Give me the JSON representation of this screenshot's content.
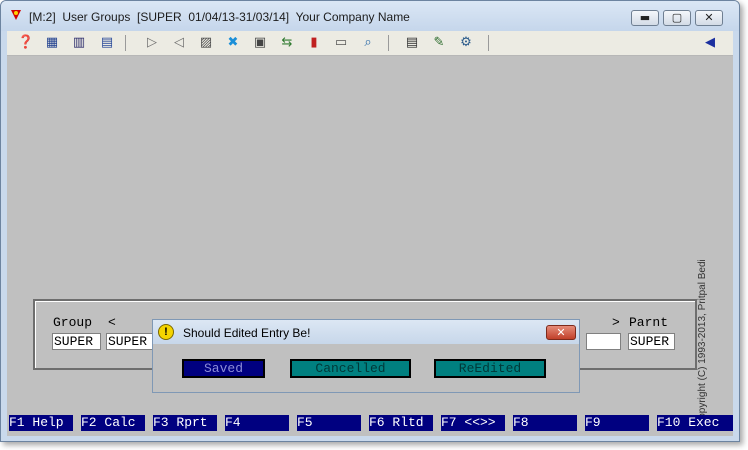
{
  "window": {
    "title": "[M:2]  User Groups  [SUPER  01/04/13-31/03/14]  Your Company Name",
    "controls": {
      "minimize": "▬",
      "maximize": "▢",
      "close": "✕"
    }
  },
  "toolbar": {
    "icons": [
      "help-icon",
      "grid-icon",
      "calculator-icon",
      "report-icon",
      "next-icon",
      "previous-icon",
      "document-icon",
      "tools-icon",
      "notes-icon",
      "transfer-icon",
      "chart-icon",
      "print-icon",
      "find-icon",
      "clipboard-icon",
      "edit-icon",
      "settings-icon",
      "exit-icon"
    ]
  },
  "copyright": "Copyright (C) 1993-2013, Pritpal Bedi",
  "form": {
    "group_label": "Group",
    "lt_marker": "<",
    "gt_marker": ">",
    "parent_label": "Parnt",
    "group_value": "SUPER",
    "name_value": "SUPER",
    "parent_value": "SUPER"
  },
  "dialog": {
    "title": "Should Edited Entry Be!",
    "close": "✕",
    "buttons": {
      "saved": "Saved",
      "cancelled": "Cancelled",
      "reedited": "ReEdited"
    }
  },
  "function_keys": [
    "F1 Help",
    "F2 Calc",
    "F3 Rprt",
    "F4",
    "F5",
    "F6 Rltd",
    "F7 <<>>",
    "F8",
    "F9",
    "F10 Exec"
  ],
  "colors": {
    "client_bg": "#c0c0c0",
    "function_key_bg": "#000080",
    "teal_button": "#008080"
  }
}
